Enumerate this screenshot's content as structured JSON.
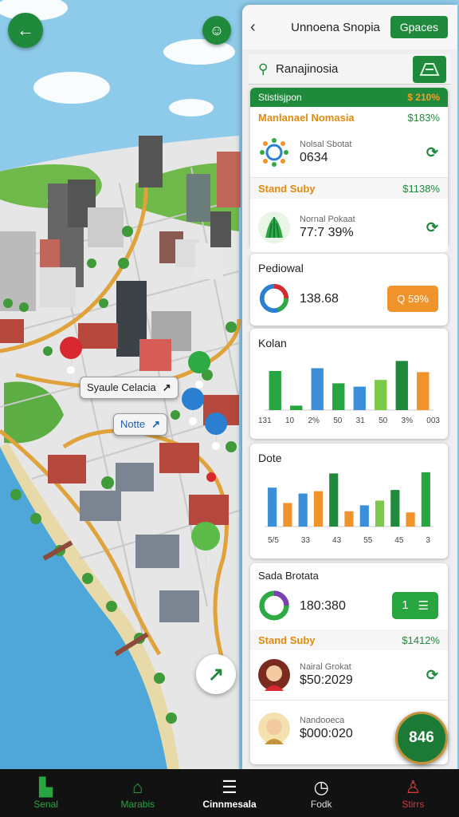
{
  "map": {
    "labels": [
      {
        "text": "Syaule Celacia",
        "arrow": "↗"
      },
      {
        "text": "Notte",
        "arrow": "↗"
      }
    ],
    "compass_glyph": "↗",
    "back_glyph": "←",
    "top_fab_glyph": "☺"
  },
  "panel": {
    "title": "Unnoena Snopia",
    "header_button": "Gpaces",
    "back_glyph": "‹",
    "search_value": "Ranajinosia",
    "sections": [
      {
        "type": "green",
        "label": "Stistisjpon",
        "value": "$ 210%"
      },
      {
        "type": "orange",
        "label": "Manlanael Nomasia",
        "value": "$183%",
        "row": {
          "small": "Nolsal Sbotat",
          "big": "0634"
        }
      },
      {
        "type": "orange",
        "label": "Stand Suby",
        "value": "$1138%",
        "row": {
          "small": "Nornal Pokaat",
          "big": "77:7 39%"
        }
      }
    ],
    "pedioval": {
      "title": "Pediowal",
      "value": "138.68",
      "badge": "Q  59%"
    },
    "chart1": {
      "title": "Kolan"
    },
    "chart2": {
      "title": "Dote"
    },
    "stats": {
      "title": "Sada Brotata",
      "value": "180:380",
      "badge": "1",
      "section_label": "Stand Suby",
      "section_value": "$1412%",
      "row1": {
        "small": "Nairal Grokat",
        "big": "$50:2029"
      },
      "row2": {
        "small": "Nandooeca",
        "big": "$000:020"
      }
    },
    "fab_label": "846"
  },
  "chart_data": [
    {
      "type": "bar",
      "title": "Kolan",
      "categories": [
        "131",
        "10",
        "2%",
        "50",
        "31",
        "50",
        "3%",
        "003"
      ],
      "values": [
        70,
        8,
        75,
        48,
        42,
        54,
        88,
        68
      ],
      "colors": [
        "#27a640",
        "#27a640",
        "#3b8fd9",
        "#27a640",
        "#3b8fd9",
        "#7cc94a",
        "#1f8a3c",
        "#f0932b"
      ],
      "ylim": [
        0,
        100
      ]
    },
    {
      "type": "bar",
      "title": "Dote",
      "categories": [
        "5/5",
        "33",
        "43",
        "55",
        "45",
        "3"
      ],
      "values": [
        66,
        40,
        56,
        60,
        90,
        26,
        36,
        44,
        62,
        24,
        92
      ],
      "colors": [
        "#3b8fd9",
        "#f0932b",
        "#3b8fd9",
        "#f0932b",
        "#1f8a3c",
        "#f0932b",
        "#3b8fd9",
        "#7cc94a",
        "#1f8a3c",
        "#f0932b",
        "#27a640"
      ],
      "ylim": [
        0,
        100
      ]
    }
  ],
  "nav": [
    {
      "label": "Senal",
      "icon": "building-icon",
      "glyph": "▙",
      "color": "#27a640"
    },
    {
      "label": "Marabis",
      "icon": "home-icon",
      "glyph": "⌂",
      "color": "#27a640"
    },
    {
      "label": "Cinnmesala",
      "icon": "list-icon",
      "glyph": "☰",
      "color": "#ffffff"
    },
    {
      "label": "Fodk",
      "icon": "clock-icon",
      "glyph": "◷",
      "color": "#ffffff"
    },
    {
      "label": "Stirrs",
      "icon": "person-icon",
      "glyph": "♙",
      "color": "#d63a3a"
    }
  ]
}
